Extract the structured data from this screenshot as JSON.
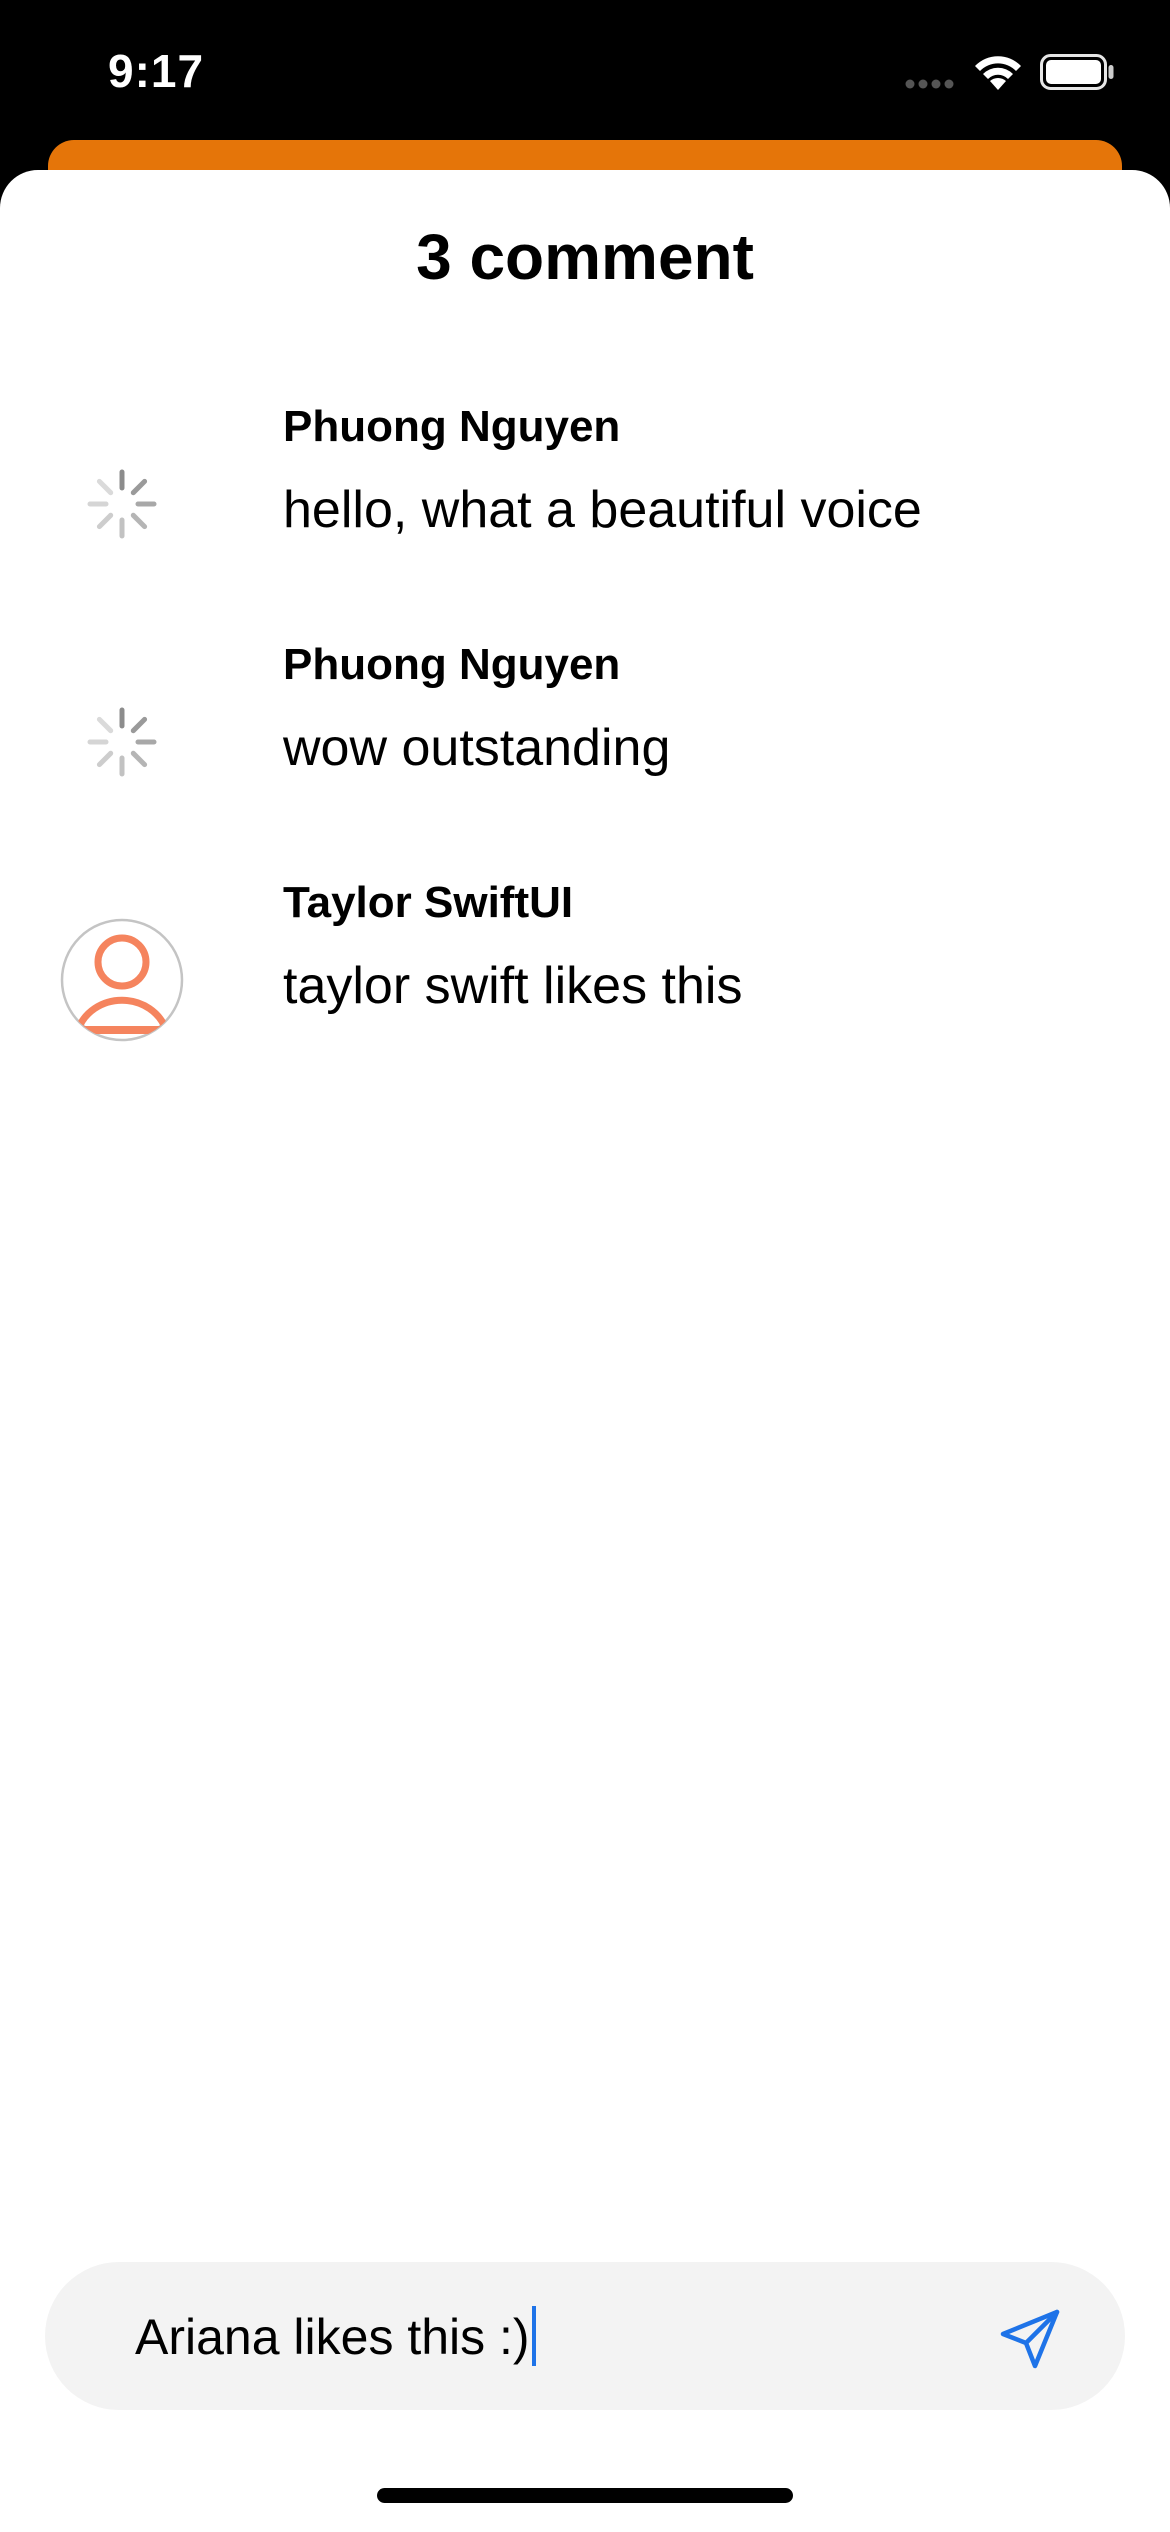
{
  "status_bar": {
    "time": "9:17"
  },
  "sheet": {
    "title": "3 comment"
  },
  "comments": [
    {
      "name": "Phuong Nguyen",
      "text": "hello, what a beautiful voice",
      "avatar": "loading-spinner-icon"
    },
    {
      "name": "Phuong Nguyen",
      "text": "wow outstanding",
      "avatar": "loading-spinner-icon"
    },
    {
      "name": "Taylor SwiftUI",
      "text": "taylor swift likes this",
      "avatar": "person-avatar-icon"
    }
  ],
  "input": {
    "value": "Ariana likes this :)",
    "send_icon": "paper-plane-icon"
  },
  "colors": {
    "behind_card": "#E57509",
    "avatar_accent": "#F5845E",
    "send_icon": "#1E73E8",
    "caret": "#1E73E8",
    "input_bg": "#F3F3F3"
  }
}
